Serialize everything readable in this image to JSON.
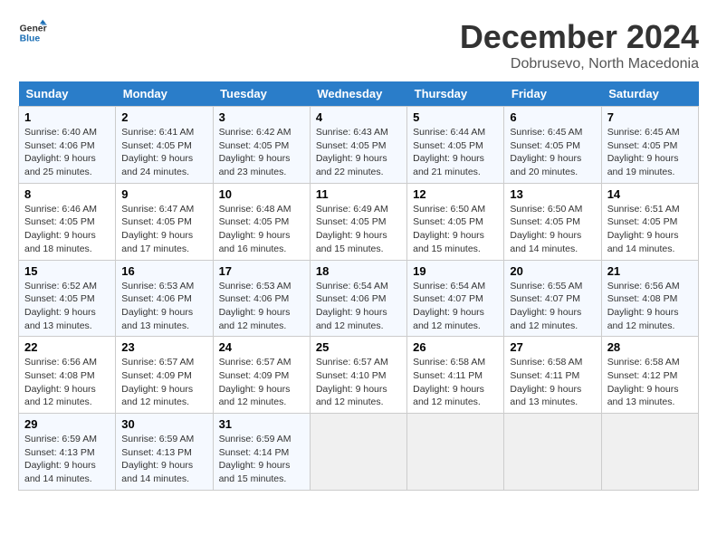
{
  "header": {
    "logo_line1": "General",
    "logo_line2": "Blue",
    "month": "December 2024",
    "location": "Dobrusevo, North Macedonia"
  },
  "days_of_week": [
    "Sunday",
    "Monday",
    "Tuesday",
    "Wednesday",
    "Thursday",
    "Friday",
    "Saturday"
  ],
  "weeks": [
    [
      {
        "day": "1",
        "info": "Sunrise: 6:40 AM\nSunset: 4:06 PM\nDaylight: 9 hours\nand 25 minutes."
      },
      {
        "day": "2",
        "info": "Sunrise: 6:41 AM\nSunset: 4:05 PM\nDaylight: 9 hours\nand 24 minutes."
      },
      {
        "day": "3",
        "info": "Sunrise: 6:42 AM\nSunset: 4:05 PM\nDaylight: 9 hours\nand 23 minutes."
      },
      {
        "day": "4",
        "info": "Sunrise: 6:43 AM\nSunset: 4:05 PM\nDaylight: 9 hours\nand 22 minutes."
      },
      {
        "day": "5",
        "info": "Sunrise: 6:44 AM\nSunset: 4:05 PM\nDaylight: 9 hours\nand 21 minutes."
      },
      {
        "day": "6",
        "info": "Sunrise: 6:45 AM\nSunset: 4:05 PM\nDaylight: 9 hours\nand 20 minutes."
      },
      {
        "day": "7",
        "info": "Sunrise: 6:45 AM\nSunset: 4:05 PM\nDaylight: 9 hours\nand 19 minutes."
      }
    ],
    [
      {
        "day": "8",
        "info": "Sunrise: 6:46 AM\nSunset: 4:05 PM\nDaylight: 9 hours\nand 18 minutes."
      },
      {
        "day": "9",
        "info": "Sunrise: 6:47 AM\nSunset: 4:05 PM\nDaylight: 9 hours\nand 17 minutes."
      },
      {
        "day": "10",
        "info": "Sunrise: 6:48 AM\nSunset: 4:05 PM\nDaylight: 9 hours\nand 16 minutes."
      },
      {
        "day": "11",
        "info": "Sunrise: 6:49 AM\nSunset: 4:05 PM\nDaylight: 9 hours\nand 15 minutes."
      },
      {
        "day": "12",
        "info": "Sunrise: 6:50 AM\nSunset: 4:05 PM\nDaylight: 9 hours\nand 15 minutes."
      },
      {
        "day": "13",
        "info": "Sunrise: 6:50 AM\nSunset: 4:05 PM\nDaylight: 9 hours\nand 14 minutes."
      },
      {
        "day": "14",
        "info": "Sunrise: 6:51 AM\nSunset: 4:05 PM\nDaylight: 9 hours\nand 14 minutes."
      }
    ],
    [
      {
        "day": "15",
        "info": "Sunrise: 6:52 AM\nSunset: 4:05 PM\nDaylight: 9 hours\nand 13 minutes."
      },
      {
        "day": "16",
        "info": "Sunrise: 6:53 AM\nSunset: 4:06 PM\nDaylight: 9 hours\nand 13 minutes."
      },
      {
        "day": "17",
        "info": "Sunrise: 6:53 AM\nSunset: 4:06 PM\nDaylight: 9 hours\nand 12 minutes."
      },
      {
        "day": "18",
        "info": "Sunrise: 6:54 AM\nSunset: 4:06 PM\nDaylight: 9 hours\nand 12 minutes."
      },
      {
        "day": "19",
        "info": "Sunrise: 6:54 AM\nSunset: 4:07 PM\nDaylight: 9 hours\nand 12 minutes."
      },
      {
        "day": "20",
        "info": "Sunrise: 6:55 AM\nSunset: 4:07 PM\nDaylight: 9 hours\nand 12 minutes."
      },
      {
        "day": "21",
        "info": "Sunrise: 6:56 AM\nSunset: 4:08 PM\nDaylight: 9 hours\nand 12 minutes."
      }
    ],
    [
      {
        "day": "22",
        "info": "Sunrise: 6:56 AM\nSunset: 4:08 PM\nDaylight: 9 hours\nand 12 minutes."
      },
      {
        "day": "23",
        "info": "Sunrise: 6:57 AM\nSunset: 4:09 PM\nDaylight: 9 hours\nand 12 minutes."
      },
      {
        "day": "24",
        "info": "Sunrise: 6:57 AM\nSunset: 4:09 PM\nDaylight: 9 hours\nand 12 minutes."
      },
      {
        "day": "25",
        "info": "Sunrise: 6:57 AM\nSunset: 4:10 PM\nDaylight: 9 hours\nand 12 minutes."
      },
      {
        "day": "26",
        "info": "Sunrise: 6:58 AM\nSunset: 4:11 PM\nDaylight: 9 hours\nand 12 minutes."
      },
      {
        "day": "27",
        "info": "Sunrise: 6:58 AM\nSunset: 4:11 PM\nDaylight: 9 hours\nand 13 minutes."
      },
      {
        "day": "28",
        "info": "Sunrise: 6:58 AM\nSunset: 4:12 PM\nDaylight: 9 hours\nand 13 minutes."
      }
    ],
    [
      {
        "day": "29",
        "info": "Sunrise: 6:59 AM\nSunset: 4:13 PM\nDaylight: 9 hours\nand 14 minutes."
      },
      {
        "day": "30",
        "info": "Sunrise: 6:59 AM\nSunset: 4:13 PM\nDaylight: 9 hours\nand 14 minutes."
      },
      {
        "day": "31",
        "info": "Sunrise: 6:59 AM\nSunset: 4:14 PM\nDaylight: 9 hours\nand 15 minutes."
      },
      {
        "day": "",
        "info": ""
      },
      {
        "day": "",
        "info": ""
      },
      {
        "day": "",
        "info": ""
      },
      {
        "day": "",
        "info": ""
      }
    ]
  ]
}
